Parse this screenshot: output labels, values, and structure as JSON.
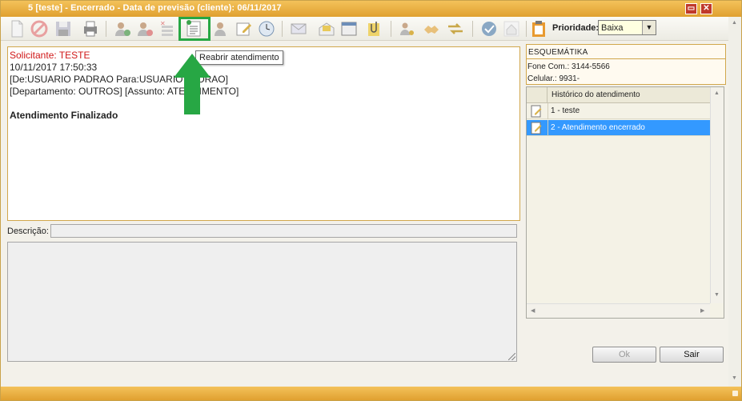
{
  "window": {
    "title": "5 [teste] - Encerrado - Data de previsão (cliente): 06/11/2017",
    "minimize_icon": "minimize-icon",
    "close_icon": "close-icon"
  },
  "toolbar": {
    "priority_label": "Prioridade:",
    "priority_value": "Baixa",
    "tooltip": "Reabrir atendimento"
  },
  "message": {
    "solicitante": "Solicitante: TESTE",
    "datetime": "10/11/2017 17:50:33",
    "from_to": "[De:USUARIO PADRAO Para:USUARIO PADRAO]",
    "dept_subject": "[Departamento: OUTROS] [Assunto: ATENDIMENTO]",
    "status": "Atendimento Finalizado"
  },
  "description": {
    "label": "Descrição:",
    "value": ""
  },
  "contact": {
    "name": "ESQUEMÁTIKA",
    "phone": "Fone Com.: 3144-5566",
    "cell": "Celular.: 9931-"
  },
  "history": {
    "header": "Histórico do atendimento",
    "rows": [
      {
        "label": "1 - teste",
        "selected": false
      },
      {
        "label": "2 - Atendimento encerrado",
        "selected": true
      }
    ]
  },
  "buttons": {
    "ok": "Ok",
    "exit": "Sair"
  },
  "colors": {
    "accent": "#e0a030",
    "highlight": "#27a744",
    "selection": "#3399ff",
    "requester": "#d01818"
  }
}
